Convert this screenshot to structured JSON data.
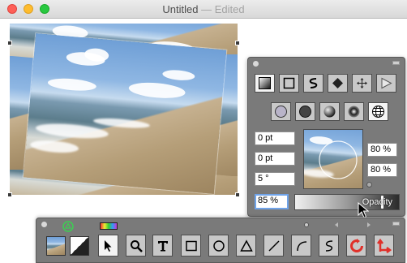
{
  "window": {
    "title": "Untitled",
    "title_separator": " — ",
    "title_status": "Edited"
  },
  "inspector": {
    "fill_tools": [
      "gradient-fill-icon",
      "rectangle-fill-icon",
      "stroke-path-icon",
      "diamond-icon",
      "move-icon",
      "play-icon"
    ],
    "style_tools": [
      "plain-circle-icon",
      "dark-circle-icon",
      "shaded-sphere-icon",
      "ringed-sphere-icon",
      "globe-icon"
    ],
    "fields": {
      "x_offset": "0 pt",
      "y_offset": "0 pt",
      "rotation": "5 °",
      "scale_x": "80 %",
      "scale_y": "80 %",
      "opacity": "85 %"
    },
    "opacity_label": "Opacity",
    "opacity_value": 0.85
  },
  "palette": {
    "tools": [
      "arrow-select-icon",
      "magnifier-icon",
      "text-tool-icon",
      "rectangle-tool-icon",
      "ellipse-tool-icon",
      "triangle-tool-icon",
      "line-tool-icon",
      "arc-tool-icon",
      "curve-tool-icon",
      "rotate-tool-icon",
      "transform-tool-icon"
    ],
    "selected_tool": "arrow-select-icon"
  },
  "colors": {
    "panel_bg": "#7a7a7a",
    "button_bg": "#c8c8c8",
    "focus_ring": "#6fa3e9",
    "rotate_red": "#e0302a"
  }
}
